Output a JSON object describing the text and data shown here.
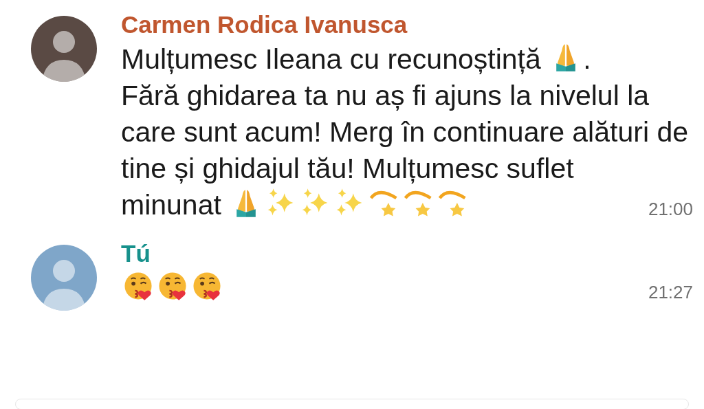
{
  "messages": [
    {
      "sender": "Carmen Rodica Ivanusca",
      "self": false,
      "time": "21:00",
      "paragraphs": [
        [
          {
            "kind": "text",
            "text": "Mulțumesc Ileana cu recunoștință "
          },
          {
            "kind": "pray"
          },
          {
            "kind": "text",
            "text": "."
          }
        ],
        [
          {
            "kind": "text",
            "text": "Fără ghidarea ta nu aș fi ajuns la nivelul la care sunt acum! Merg în continuare alături de tine și ghidajul tău! Mulțumesc suflet"
          }
        ],
        [
          {
            "kind": "text",
            "text": "minunat "
          },
          {
            "kind": "pray"
          },
          {
            "kind": "sparkles"
          },
          {
            "kind": "sparkles"
          },
          {
            "kind": "sparkles"
          },
          {
            "kind": "swirl"
          },
          {
            "kind": "swirl"
          },
          {
            "kind": "swirl"
          }
        ]
      ]
    },
    {
      "sender": "Tú",
      "self": true,
      "time": "21:27",
      "paragraphs": [
        [
          {
            "kind": "kiss"
          },
          {
            "kind": "kiss"
          },
          {
            "kind": "kiss"
          }
        ]
      ]
    }
  ]
}
